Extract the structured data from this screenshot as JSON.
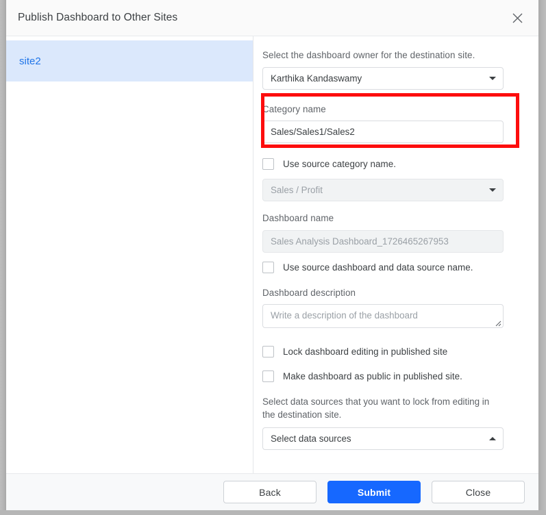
{
  "dialog": {
    "title": "Publish Dashboard to Other Sites",
    "close_icon": "close-icon"
  },
  "sidebar": {
    "items": [
      {
        "label": "site2",
        "selected": true
      }
    ]
  },
  "form": {
    "owner": {
      "label": "Select the dashboard owner for the destination site.",
      "value": "Karthika Kandaswamy",
      "caret_icon": "chevron-down-icon"
    },
    "category": {
      "label": "Category name",
      "value": "Sales/Sales1/Sales2",
      "highlighted": true,
      "highlight_color": "#fd0d0d"
    },
    "use_source_category": {
      "label": "Use source category name.",
      "checked": false
    },
    "category_select": {
      "placeholder": "Sales / Profit",
      "caret_icon": "chevron-down-icon",
      "disabled": true
    },
    "dashboard_name": {
      "label": "Dashboard name",
      "value": "Sales Analysis Dashboard_1726465267953",
      "disabled": true
    },
    "use_source_dashboard": {
      "label": "Use source dashboard and data source name.",
      "checked": false
    },
    "dashboard_description": {
      "label": "Dashboard description",
      "placeholder": "Write a description of the dashboard",
      "value": "",
      "resize_icon": "resize-grip-icon"
    },
    "lock_editing": {
      "label": "Lock dashboard editing in published site",
      "checked": false
    },
    "make_public": {
      "label": "Make dashboard as public in published site.",
      "checked": false
    },
    "data_sources": {
      "label": "Select data sources that you want to lock from editing in the destination site.",
      "placeholder": "Select data sources",
      "caret_icon": "chevron-up-icon",
      "expanded": true
    }
  },
  "footer": {
    "back_label": "Back",
    "submit_label": "Submit",
    "close_label": "Close",
    "primary_color": "#1668ff"
  }
}
